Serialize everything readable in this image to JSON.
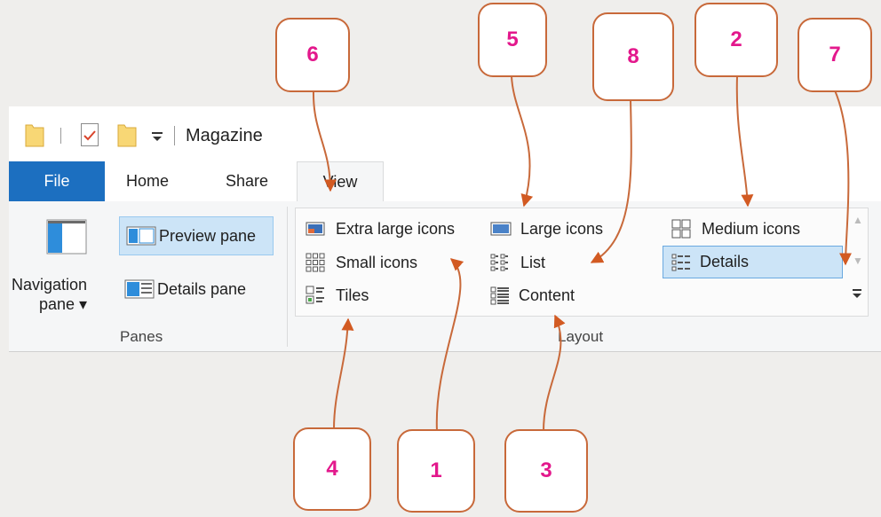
{
  "window": {
    "title": "Magazine"
  },
  "tabs": [
    {
      "label": "File"
    },
    {
      "label": "Home"
    },
    {
      "label": "Share"
    },
    {
      "label": "View"
    }
  ],
  "panes": {
    "navigation_label_1": "Navigation",
    "navigation_label_2": "pane ▾",
    "preview": "Preview pane",
    "details": "Details pane",
    "group": "Panes"
  },
  "layout": {
    "extra_large": "Extra large icons",
    "large": "Large icons",
    "medium": "Medium icons",
    "small": "Small icons",
    "list": "List",
    "details": "Details",
    "tiles": "Tiles",
    "content": "Content",
    "group": "Layout"
  },
  "callouts": [
    "6",
    "5",
    "8",
    "2",
    "7",
    "4",
    "1",
    "3"
  ],
  "colors": {
    "file_tab": "#1c6fc0",
    "callout_text": "#e3188c",
    "callout_border": "#c8693a",
    "selected": "#cce4f7"
  }
}
